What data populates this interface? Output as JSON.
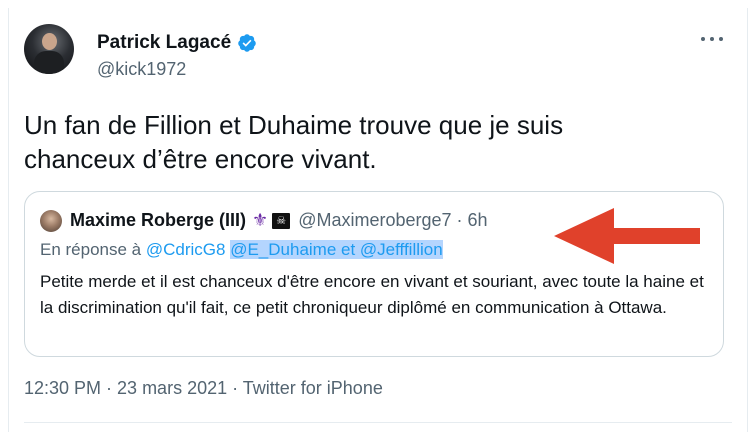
{
  "author": {
    "name": "Patrick Lagacé",
    "handle": "@kick1972",
    "verified": true
  },
  "tweet": {
    "text_line1": "Un fan de Fillion et Duhaime trouve que je suis",
    "text_line2": "chanceux d’être encore vivant."
  },
  "quoted": {
    "name": "Maxime Roberge (III)",
    "emoji1": "⚜",
    "emoji2": "☠",
    "handle_time": "@Maximeroberge7 · 6h",
    "reply_prefix": "En réponse à ",
    "reply_to1": "@CdricG8",
    "reply_highlighted": "@E_Duhaime  et  @Jefffillion",
    "text": "Petite merde et il est chanceux d'être encore en vivant et souriant,  avec toute la haine et la discrimination qu'il fait, ce petit chroniqueur diplômé en communication à Ottawa."
  },
  "meta": {
    "time_date": "12:30 PM · 23 mars 2021 · ",
    "source": "Twitter for iPhone"
  },
  "colors": {
    "accent": "#1d9bf0",
    "highlight": "#b4d5fe",
    "arrow": "#e0412b"
  },
  "icons": {
    "verified": "verified-badge-icon",
    "more": "more-dots-icon",
    "arrow": "red-arrow-annotation"
  }
}
